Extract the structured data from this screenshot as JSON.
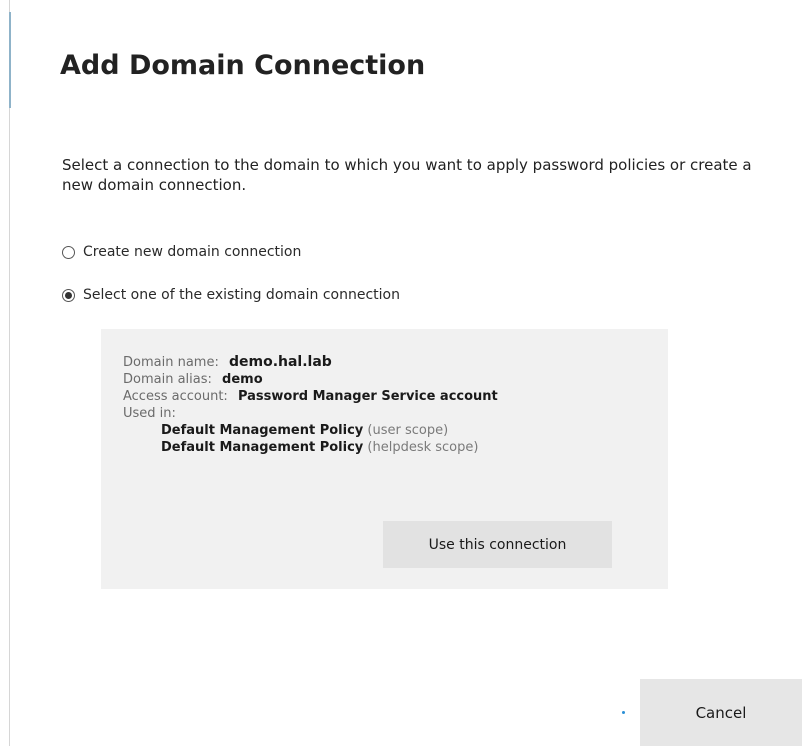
{
  "dialog": {
    "title": "Add Domain Connection",
    "description": "Select a connection to the domain to which you want to apply password policies or create a new domain connection."
  },
  "options": [
    {
      "label": "Create new domain connection",
      "selected": false
    },
    {
      "label": "Select one of the existing domain connection",
      "selected": true
    }
  ],
  "connection": {
    "domain_name_label": "Domain name:",
    "domain_name": "demo.hal.lab",
    "domain_alias_label": "Domain alias:",
    "domain_alias": "demo",
    "access_account_label": "Access account:",
    "access_account": "Password Manager Service account",
    "used_in_label": "Used in:",
    "policies": [
      {
        "name": "Default Management Policy",
        "scope": "(user scope)"
      },
      {
        "name": "Default Management Policy",
        "scope": "(helpdesk scope)"
      }
    ],
    "use_button_label": "Use this connection"
  },
  "footer": {
    "cancel_label": "Cancel"
  },
  "colors": {
    "panel_bg": "#f1f1f1",
    "button_bg": "#e2e2e2",
    "accent_dot": "#2a8fd6"
  }
}
